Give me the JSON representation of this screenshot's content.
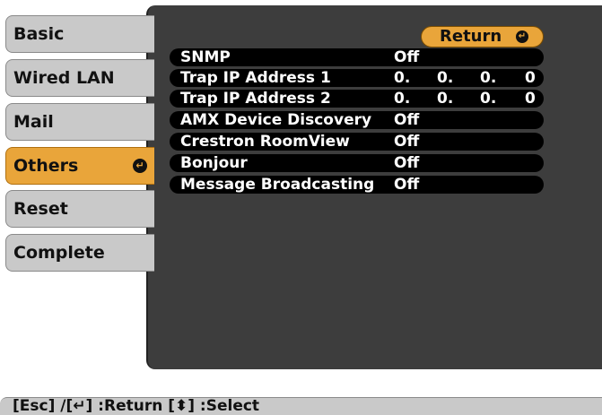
{
  "sidebar": {
    "items": [
      {
        "label": "Basic"
      },
      {
        "label": "Wired LAN"
      },
      {
        "label": "Mail"
      },
      {
        "label": "Others",
        "selected": true
      },
      {
        "label": "Reset"
      },
      {
        "label": "Complete"
      }
    ],
    "selected_glyph": "↵"
  },
  "main": {
    "return_label": "Return",
    "return_glyph": "↵",
    "settings": [
      {
        "label": "SNMP",
        "value": "Off"
      },
      {
        "label": "Trap IP Address 1",
        "ip": [
          "0.",
          "0.",
          "0.",
          "0"
        ]
      },
      {
        "label": "Trap IP Address 2",
        "ip": [
          "0.",
          "0.",
          "0.",
          "0"
        ]
      },
      {
        "label": "AMX Device Discovery",
        "value": "Off"
      },
      {
        "label": "Crestron RoomView",
        "value": "Off"
      },
      {
        "label": "Bonjour",
        "value": "Off"
      },
      {
        "label": "Message Broadcasting",
        "value": "Off"
      }
    ]
  },
  "footer": {
    "text": "[Esc] /[↵] :Return  [⬍] :Select"
  },
  "colors": {
    "panel": "#3d3d3d",
    "accent": "#e9a53a",
    "sidebar": "#c9c9c9",
    "row": "#000000"
  }
}
